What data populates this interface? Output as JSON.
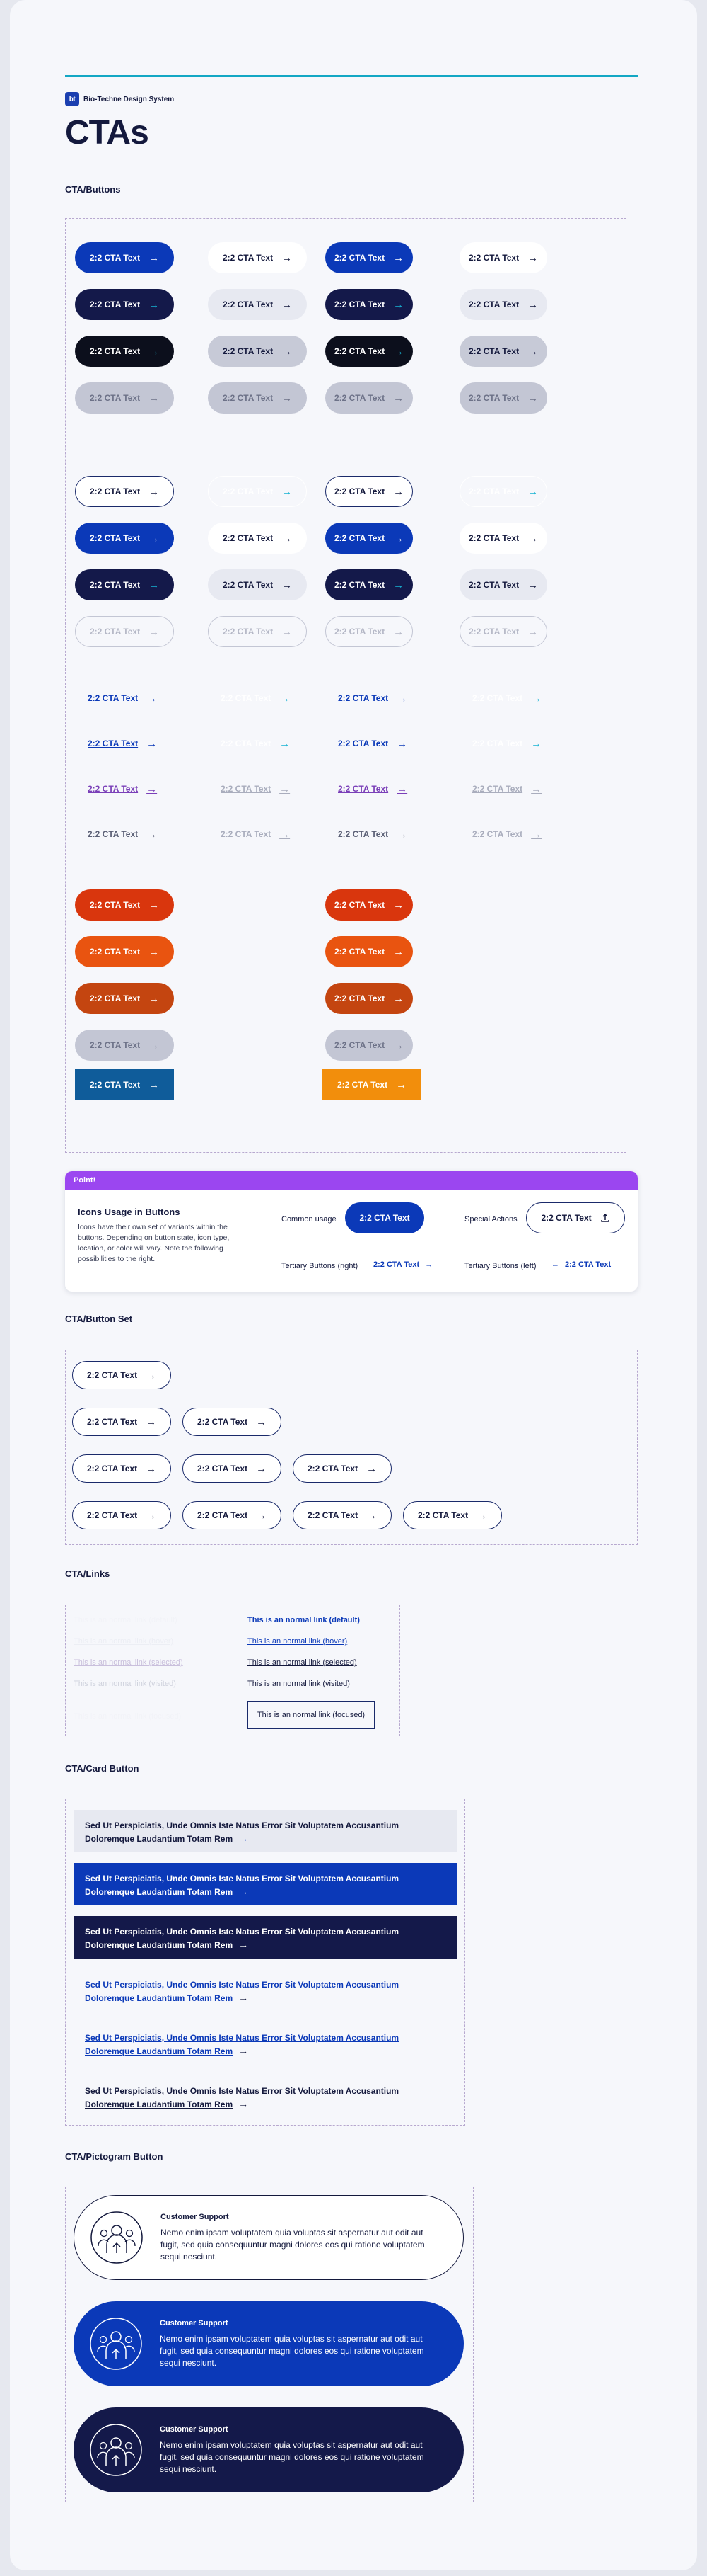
{
  "brand": {
    "logo": "bt",
    "name": "Bio-Techne Design System"
  },
  "page_title": "CTAs",
  "sections": {
    "buttons": "CTA/Buttons",
    "button_set": "CTA/Button Set",
    "links": "CTA/Links",
    "card_button": "CTA/Card Button",
    "pictogram_button": "CTA/Pictogram Button"
  },
  "cta_label": "2:2 CTA Text",
  "arrow": "→",
  "colors": {
    "accent_cyan": "#13a7c4",
    "primary_blue": "#0b39b8",
    "navy": "#14194a",
    "orange": "#d9360d",
    "purple": "#9b46f0"
  },
  "point": {
    "badge": "Point!",
    "title": "Icons Usage in Buttons",
    "description": "Icons have their own set of variants within the buttons. Depending on button state, icon type, location, or color will vary. Note the following possibilities to the right.",
    "common_usage_label": "Common usage",
    "special_actions_label": "Special Actions",
    "tertiary_right_label": "Tertiary Buttons (right)",
    "tertiary_left_label": "Tertiary Buttons (left)",
    "upload_icon": "upload-icon",
    "back_arrow": "←"
  },
  "links": {
    "left": [
      "This is an normal link (default)",
      "This is an normal link (hover)",
      "This is an normal link (selected)",
      "This is an normal link (visited)",
      "This is an normal link (focused)"
    ],
    "right": [
      "This is an normal link (default)",
      "This is an normal link (hover)",
      "This is an normal link (selected)",
      "This is an normal link (visited)",
      "This is an normal link (focused)"
    ]
  },
  "card_button": {
    "line1": "Sed Ut Perspiciatis, Unde Omnis Iste Natus Error Sit Voluptatem Accusantium",
    "line2": "Doloremque Laudantium Totam Rem"
  },
  "pictogram": {
    "title": "Customer Support",
    "description": "Nemo enim ipsam voluptatem quia voluptas sit aspernatur aut odit aut fugit, sed quia consequuntur magni dolores eos qui ratione voluptatem sequi nesciunt.",
    "icon": "customer-support-icon"
  }
}
